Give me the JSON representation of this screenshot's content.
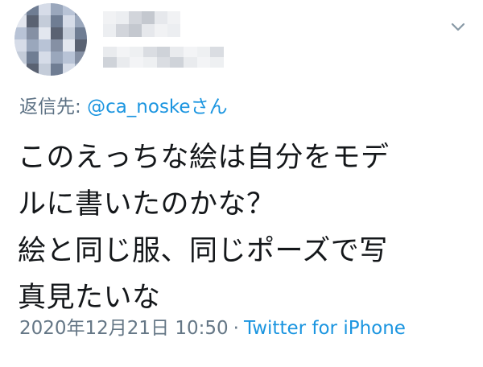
{
  "tweet": {
    "reply_prefix": "返信先: ",
    "reply_mention": "@ca_noskeさん",
    "body_lines": [
      "このえっちな絵は自分をモデ",
      "ルに書いたのかな？",
      "絵と同じ服、同じポーズで写",
      "真見たいな"
    ],
    "timestamp": "2020年12月21日 10:50",
    "separator": "·",
    "source": "Twitter for iPhone"
  },
  "icons": {
    "menu": "chevron-down-icon"
  },
  "colors": {
    "link": "#1b95e0",
    "text": "#14171a",
    "secondary": "#657786"
  }
}
